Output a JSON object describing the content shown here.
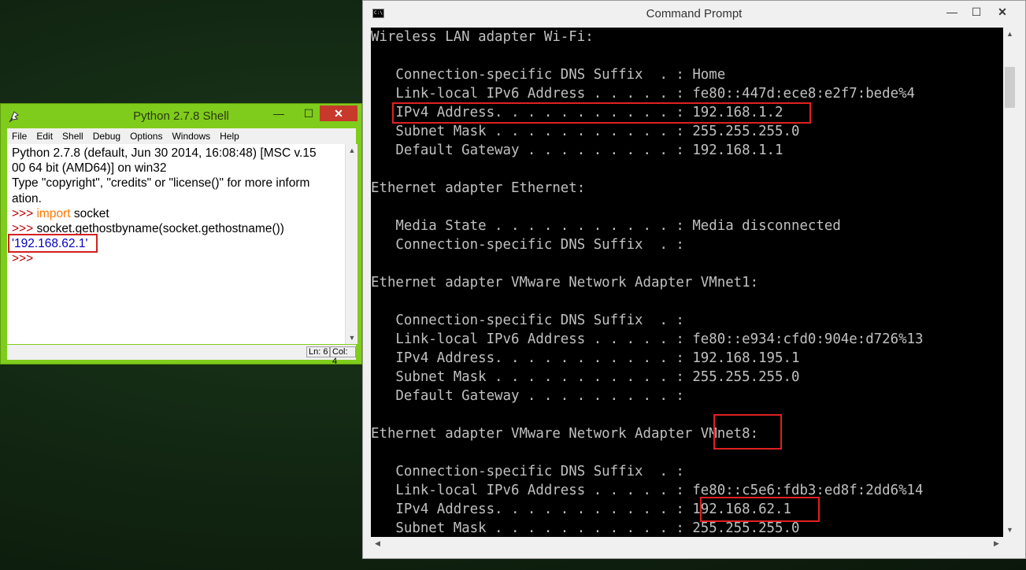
{
  "python_shell": {
    "title": "Python 2.7.8 Shell",
    "controls": {
      "minimize": "—",
      "maximize": "☐",
      "close": "✕"
    },
    "menu": [
      "File",
      "Edit",
      "Shell",
      "Debug",
      "Options",
      "Windows",
      "Help"
    ],
    "lines": {
      "banner1": "Python 2.7.8 (default, Jun 30 2014, 16:08:48) [MSC v.15",
      "banner2": "00 64 bit (AMD64)] on win32",
      "banner3": "Type \"copyright\", \"credits\" or \"license()\" for more inform",
      "banner4": "ation.",
      "prompt": ">>> ",
      "keyword_import": "import",
      "import_rest": " socket",
      "command2": "socket.gethostbyname(socket.gethostname())",
      "output": "'192.168.62.1'",
      "prompt_last": ">>>"
    },
    "status": {
      "line": "Ln: 6",
      "col": "Col: 4"
    }
  },
  "command_prompt": {
    "title": "Command Prompt",
    "icon_text": "C:\\",
    "controls": {
      "minimize": "—",
      "maximize": "☐",
      "close": "✕"
    },
    "lines": [
      "Wireless LAN adapter Wi-Fi:",
      "",
      "   Connection-specific DNS Suffix  . : Home",
      "   Link-local IPv6 Address . . . . . : fe80::447d:ece8:e2f7:bede%4",
      "   IPv4 Address. . . . . . . . . . . : 192.168.1.2",
      "   Subnet Mask . . . . . . . . . . . : 255.255.255.0",
      "   Default Gateway . . . . . . . . . : 192.168.1.1",
      "",
      "Ethernet adapter Ethernet:",
      "",
      "   Media State . . . . . . . . . . . : Media disconnected",
      "   Connection-specific DNS Suffix  . :",
      "",
      "Ethernet adapter VMware Network Adapter VMnet1:",
      "",
      "   Connection-specific DNS Suffix  . :",
      "   Link-local IPv6 Address . . . . . : fe80::e934:cfd0:904e:d726%13",
      "   IPv4 Address. . . . . . . . . . . : 192.168.195.1",
      "   Subnet Mask . . . . . . . . . . . : 255.255.255.0",
      "   Default Gateway . . . . . . . . . :",
      "",
      "Ethernet adapter VMware Network Adapter VMnet8:",
      "",
      "   Connection-specific DNS Suffix  . :",
      "   Link-local IPv6 Address . . . . . : fe80::c5e6:fdb3:ed8f:2dd6%14",
      "   IPv4 Address. . . . . . . . . . . : 192.168.62.1",
      "   Subnet Mask . . . . . . . . . . . : 255.255.255.0"
    ]
  },
  "icons": {
    "python_icon": "python-feather-icon",
    "cmd_icon": "console-icon",
    "scroll_up": "▲",
    "scroll_down": "▼",
    "scroll_left": "◀",
    "scroll_right": "▶"
  },
  "highlight_color": "#d42020"
}
